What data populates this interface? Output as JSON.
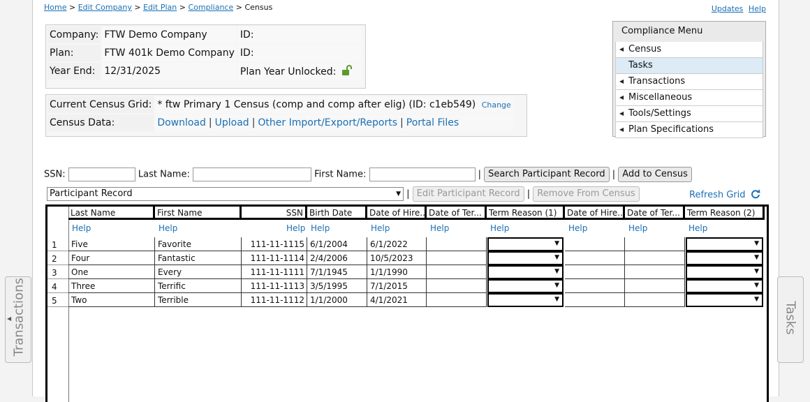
{
  "breadcrumb": {
    "items": [
      "Home",
      "Edit Company",
      "Edit Plan",
      "Compliance"
    ],
    "current": "Census"
  },
  "toplinks": {
    "updates": "Updates",
    "help": "Help"
  },
  "info": {
    "company_label": "Company:",
    "company_value": "FTW Demo Company",
    "id1_label": "ID:",
    "plan_label": "Plan:",
    "plan_value": "FTW 401k Demo Company",
    "id2_label": "ID:",
    "yearend_label": "Year End:",
    "yearend_value": "12/31/2025",
    "unlocked_label": "Plan Year Unlocked:"
  },
  "census_box": {
    "grid_label": "Current Census Grid:",
    "grid_value": "* ftw Primary 1 Census (comp and comp after elig) (ID: c1eb549)",
    "change_link": "Change",
    "data_label": "Census Data:",
    "links": [
      "Download",
      "Upload",
      "Other Import/Export/Reports",
      "Portal Files"
    ]
  },
  "menu": {
    "title": "Compliance Menu",
    "items": [
      "Census",
      "Tasks",
      "Transactions",
      "Miscellaneous",
      "Tools/Settings",
      "Plan Specifications"
    ]
  },
  "search": {
    "ssn_label": "SSN:",
    "last_label": "Last Name:",
    "first_label": "First Name:",
    "search_button": "Search Participant Record",
    "add_button": "Add to Census"
  },
  "toolbar": {
    "record_type": "Participant Record",
    "edit_button": "Edit Participant Record",
    "remove_button": "Remove From Census",
    "refresh": "Refresh Grid"
  },
  "grid": {
    "columns": [
      "Last Name",
      "First Name",
      "SSN",
      "Birth Date",
      "Date of Hire...",
      "Date of Ter...",
      "Term Reason (1)",
      "Date of Hire...",
      "Date of Ter...",
      "Term Reason (2)"
    ],
    "help": "Help",
    "rows": [
      {
        "n": "1",
        "last": "Five",
        "first": "Favorite",
        "ssn": "111-11-1115",
        "birth": "6/1/2004",
        "hire": "6/1/2022"
      },
      {
        "n": "2",
        "last": "Four",
        "first": "Fantastic",
        "ssn": "111-11-1114",
        "birth": "2/4/2006",
        "hire": "10/5/2023"
      },
      {
        "n": "3",
        "last": "One",
        "first": "Every",
        "ssn": "111-11-1111",
        "birth": "7/1/1945",
        "hire": "1/1/1990"
      },
      {
        "n": "4",
        "last": "Three",
        "first": "Terrific",
        "ssn": "111-11-1113",
        "birth": "3/5/1995",
        "hire": "7/1/2015"
      },
      {
        "n": "5",
        "last": "Two",
        "first": "Terrible",
        "ssn": "111-11-1112",
        "birth": "1/1/2000",
        "hire": "4/1/2021"
      }
    ]
  },
  "side_tabs": {
    "left": "Transactions",
    "right": "Tasks"
  },
  "colors": {
    "link": "#1a6fb5",
    "active_menu": "#dcebf5",
    "unlock_icon": "#5a9a2a"
  }
}
